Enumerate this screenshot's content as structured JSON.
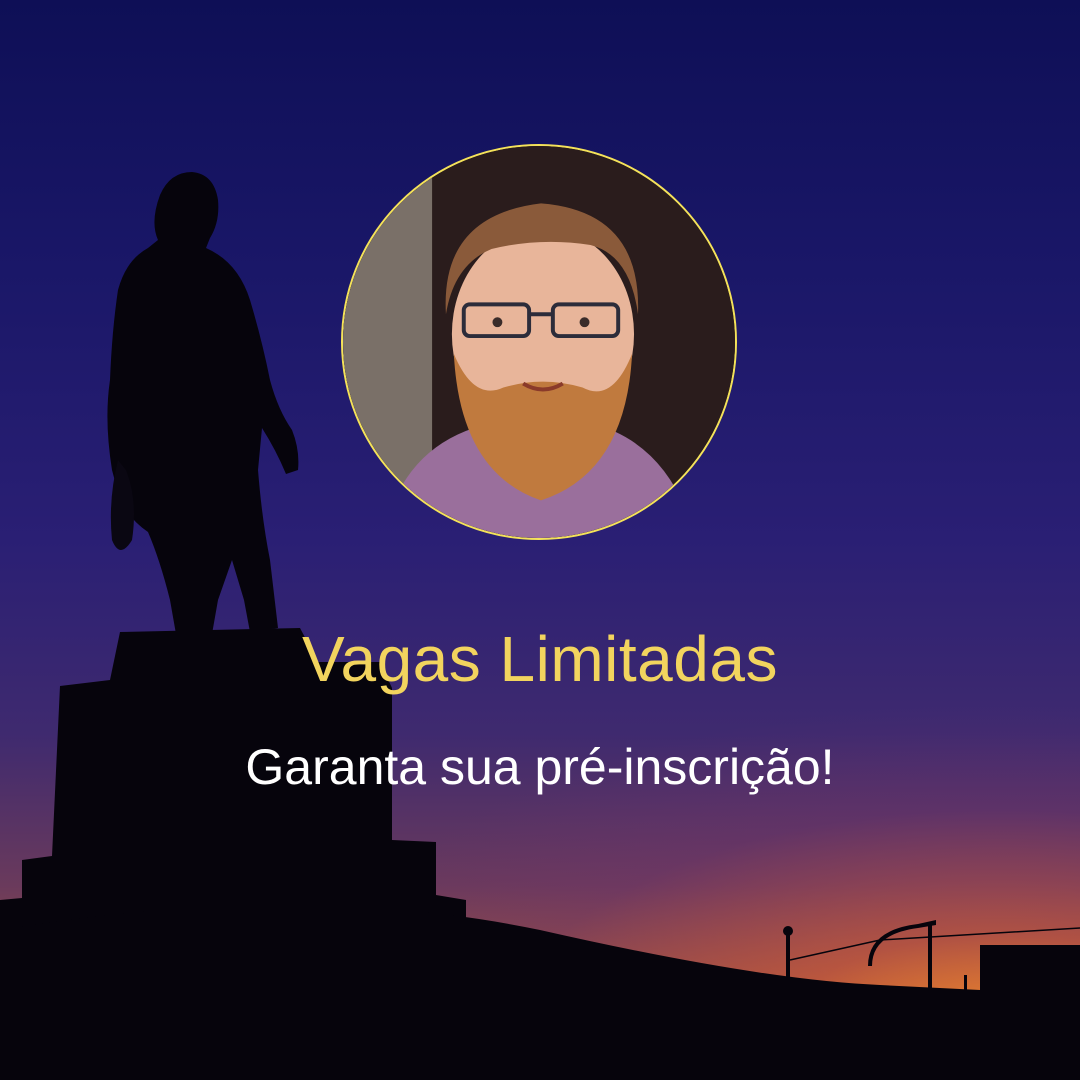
{
  "headline": "Vagas Limitadas",
  "subline": "Garanta sua pré-inscrição!",
  "colors": {
    "headline": "#f2d45e",
    "subline": "#ffffff",
    "avatar_border": "#f4e25a",
    "sky_top": "#0e0f56",
    "sky_bottom": "#d9822b"
  },
  "icons": {
    "statue": "statue-silhouette",
    "avatar": "speaker-portrait"
  }
}
